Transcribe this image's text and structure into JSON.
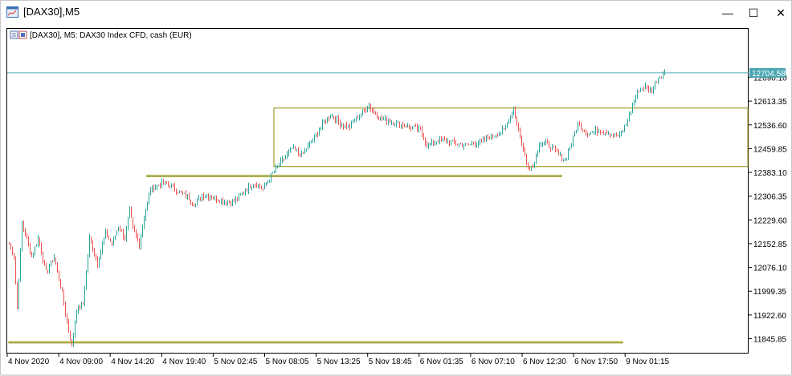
{
  "window": {
    "title": "[DAX30],M5",
    "minimize_glyph": "—",
    "maximize_glyph": "☐",
    "close_glyph": "✕"
  },
  "chart_info": {
    "text": "[DAX30], M5:  DAX30 Index CFD, cash (EUR)"
  },
  "price_axis": {
    "labels": [
      "12690.10",
      "12613.35",
      "12536.60",
      "12459.85",
      "12383.10",
      "12306.35",
      "12229.60",
      "12152.85",
      "12076.10",
      "11999.35",
      "11922.60",
      "11845.85"
    ],
    "current_price": "12704.58",
    "current_price_color": "#4ba6b3"
  },
  "time_axis": {
    "labels": [
      "4 Nov 2020",
      "4 Nov 09:00",
      "4 Nov 14:20",
      "4 Nov 19:40",
      "5 Nov 02:45",
      "5 Nov 08:05",
      "5 Nov 13:25",
      "5 Nov 18:45",
      "6 Nov 01:35",
      "6 Nov 07:10",
      "6 Nov 12:30",
      "6 Nov 17:50",
      "9 Nov 01:15"
    ]
  },
  "colors": {
    "bull": "#26a69a",
    "bear": "#ef5350",
    "zone": "#8b8b00",
    "grid_border": "#000000"
  },
  "chart_data": {
    "type": "candlestick",
    "symbol": "[DAX30]",
    "timeframe": "M5",
    "ylim": [
      11810,
      12740
    ],
    "anchors": [
      [
        0,
        12150
      ],
      [
        3,
        12110
      ],
      [
        5,
        11950
      ],
      [
        8,
        12220
      ],
      [
        14,
        12110
      ],
      [
        18,
        12170
      ],
      [
        23,
        12060
      ],
      [
        28,
        12110
      ],
      [
        33,
        11990
      ],
      [
        35,
        11930
      ],
      [
        39,
        11820
      ],
      [
        42,
        11940
      ],
      [
        46,
        11960
      ],
      [
        50,
        12170
      ],
      [
        55,
        12090
      ],
      [
        60,
        12190
      ],
      [
        64,
        12150
      ],
      [
        68,
        12210
      ],
      [
        72,
        12170
      ],
      [
        75,
        12260
      ],
      [
        77,
        12200
      ],
      [
        81,
        12150
      ],
      [
        84,
        12240
      ],
      [
        88,
        12330
      ],
      [
        92,
        12340
      ],
      [
        96,
        12350
      ],
      [
        100,
        12340
      ],
      [
        106,
        12320
      ],
      [
        112,
        12300
      ],
      [
        116,
        12280
      ],
      [
        120,
        12310
      ],
      [
        128,
        12300
      ],
      [
        134,
        12290
      ],
      [
        140,
        12290
      ],
      [
        146,
        12320
      ],
      [
        152,
        12350
      ],
      [
        158,
        12330
      ],
      [
        164,
        12380
      ],
      [
        170,
        12420
      ],
      [
        176,
        12460
      ],
      [
        182,
        12440
      ],
      [
        188,
        12480
      ],
      [
        194,
        12530
      ],
      [
        200,
        12570
      ],
      [
        206,
        12540
      ],
      [
        212,
        12530
      ],
      [
        218,
        12570
      ],
      [
        224,
        12600
      ],
      [
        230,
        12560
      ],
      [
        236,
        12550
      ],
      [
        242,
        12540
      ],
      [
        250,
        12530
      ],
      [
        256,
        12520
      ],
      [
        260,
        12470
      ],
      [
        268,
        12490
      ],
      [
        276,
        12480
      ],
      [
        284,
        12470
      ],
      [
        292,
        12480
      ],
      [
        300,
        12500
      ],
      [
        308,
        12520
      ],
      [
        314,
        12590
      ],
      [
        318,
        12500
      ],
      [
        322,
        12410
      ],
      [
        326,
        12400
      ],
      [
        330,
        12480
      ],
      [
        336,
        12470
      ],
      [
        342,
        12440
      ],
      [
        346,
        12420
      ],
      [
        350,
        12480
      ],
      [
        354,
        12540
      ],
      [
        360,
        12510
      ],
      [
        368,
        12520
      ],
      [
        374,
        12510
      ],
      [
        380,
        12500
      ],
      [
        384,
        12540
      ],
      [
        388,
        12600
      ],
      [
        392,
        12650
      ],
      [
        396,
        12660
      ],
      [
        400,
        12650
      ],
      [
        404,
        12690
      ],
      [
        408,
        12705
      ]
    ],
    "zones": [
      {
        "from_index": 86,
        "to_index": 344,
        "high": 12374,
        "low": 12369
      },
      {
        "from_index": 165,
        "to_index": 460,
        "high": 12591,
        "low": 12402
      },
      {
        "from_index": 0,
        "to_index": 382,
        "high": 11836,
        "low": 11834
      }
    ],
    "current_price": 12704.58
  }
}
